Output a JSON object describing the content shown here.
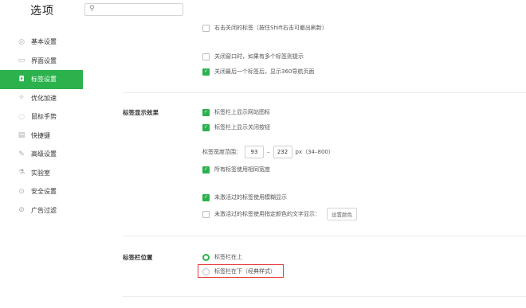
{
  "app": {
    "title": "选项"
  },
  "search": {
    "placeholder": ""
  },
  "sidebar": {
    "items": [
      {
        "label": "基本设置",
        "icon": "gear-icon",
        "glyph": "◎"
      },
      {
        "label": "界面设置",
        "icon": "window-icon",
        "glyph": "▭"
      },
      {
        "label": "标签设置",
        "icon": "tab-icon",
        "glyph": "◘"
      },
      {
        "label": "优化加速",
        "icon": "rocket-icon",
        "glyph": "✧"
      },
      {
        "label": "鼠标手势",
        "icon": "mouse-icon",
        "glyph": "◌"
      },
      {
        "label": "快捷键",
        "icon": "keyboard-icon",
        "glyph": "▤"
      },
      {
        "label": "高级设置",
        "icon": "wrench-icon",
        "glyph": "✎"
      },
      {
        "label": "实验室",
        "icon": "flask-icon",
        "glyph": "⚗"
      },
      {
        "label": "安全设置",
        "icon": "shield-icon",
        "glyph": "⊙"
      },
      {
        "label": "广告过滤",
        "icon": "block-icon",
        "glyph": "⊘"
      }
    ],
    "active_index": 2
  },
  "main": {
    "top_options": [
      {
        "label": "右击关闭的标签（按住Shift右击可撤出刷新）",
        "checked": false
      },
      {
        "label": "关闭窗口时，如果有多个标签则提示",
        "checked": false
      },
      {
        "label": "关闭最后一个标签后，显示360导航页面",
        "checked": true
      }
    ],
    "tab_display": {
      "title": "标签显示效果",
      "options": [
        {
          "label": "标签栏上显示网站图标",
          "checked": true
        },
        {
          "label": "标签栏上显示关闭按钮",
          "checked": true
        }
      ],
      "width_label": "标签宽度范围：",
      "width_min": "93",
      "width_sep": "–",
      "width_max": "232",
      "width_unit": "px（34–800）",
      "same_width": {
        "label": "所有标签使用相同宽度",
        "checked": true
      },
      "unread_options": [
        {
          "label": "未激活过的标签使用模糊显示",
          "checked": true
        },
        {
          "label": "未激活过的标签使用指定颜色的文字显示：",
          "checked": false
        }
      ],
      "color_button": "设置颜色"
    },
    "tab_position": {
      "title": "标签栏位置",
      "options": [
        {
          "label": "标签栏在上",
          "checked": true
        },
        {
          "label": "标签栏在下（经典样式）",
          "checked": false
        }
      ]
    }
  },
  "colors": {
    "accent": "#2bb24c",
    "highlight": "#e53935"
  }
}
